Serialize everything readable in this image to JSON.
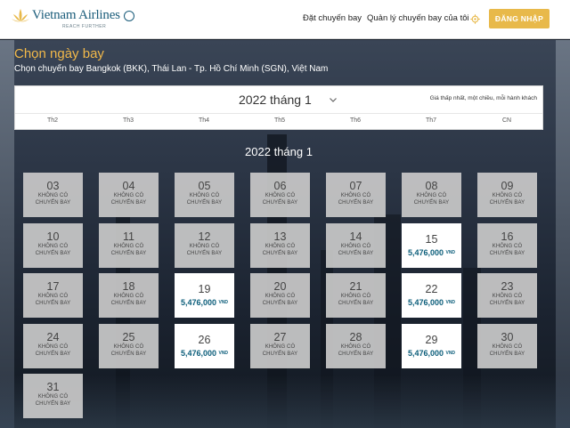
{
  "header": {
    "logo_text": "Vietnam Airlines",
    "logo_tagline": "REACH FURTHER",
    "nav": [
      "Đặt chuyến bay",
      "Quản lý chuyến bay của tôi"
    ],
    "login_label": "ĐĂNG NHẬP",
    "settings_icon": "gear-icon",
    "colors": {
      "accent": "#e8b94a",
      "brand": "#1a5c7a",
      "price": "#0b5d7a"
    }
  },
  "page": {
    "title": "Chọn ngày bay",
    "route": "Chọn chuyến bay Bangkok (BKK), Thái Lan - Tp. Hồ Chí Minh (SGN), Việt Nam"
  },
  "month_bar": {
    "selected_month": "2022 tháng 1",
    "note": "Giá thấp nhất, một chiều, mỗi hành khách",
    "days_of_week": [
      "Th2",
      "Th3",
      "Th4",
      "Th5",
      "Th6",
      "Th7",
      "CN"
    ]
  },
  "calendar": {
    "title": "2022 tháng 1",
    "no_flight_label_1": "KHÔNG CÓ",
    "no_flight_label_2": "CHUYẾN BAY",
    "currency": "VND",
    "rows": [
      [
        {
          "day": "03"
        },
        {
          "day": "04"
        },
        {
          "day": "05"
        },
        {
          "day": "06"
        },
        {
          "day": "07"
        },
        {
          "day": "08"
        },
        {
          "day": "09"
        }
      ],
      [
        {
          "day": "10"
        },
        {
          "day": "11"
        },
        {
          "day": "12"
        },
        {
          "day": "13"
        },
        {
          "day": "14"
        },
        {
          "day": "15",
          "price": "5,476,000"
        },
        {
          "day": "16"
        }
      ],
      [
        {
          "day": "17"
        },
        {
          "day": "18"
        },
        {
          "day": "19",
          "price": "5,476,000"
        },
        {
          "day": "20"
        },
        {
          "day": "21"
        },
        {
          "day": "22",
          "price": "5,476,000"
        },
        {
          "day": "23"
        }
      ],
      [
        {
          "day": "24"
        },
        {
          "day": "25"
        },
        {
          "day": "26",
          "price": "5,476,000"
        },
        {
          "day": "27"
        },
        {
          "day": "28"
        },
        {
          "day": "29",
          "price": "5,476,000"
        },
        {
          "day": "30"
        }
      ],
      [
        {
          "day": "31"
        }
      ]
    ]
  }
}
